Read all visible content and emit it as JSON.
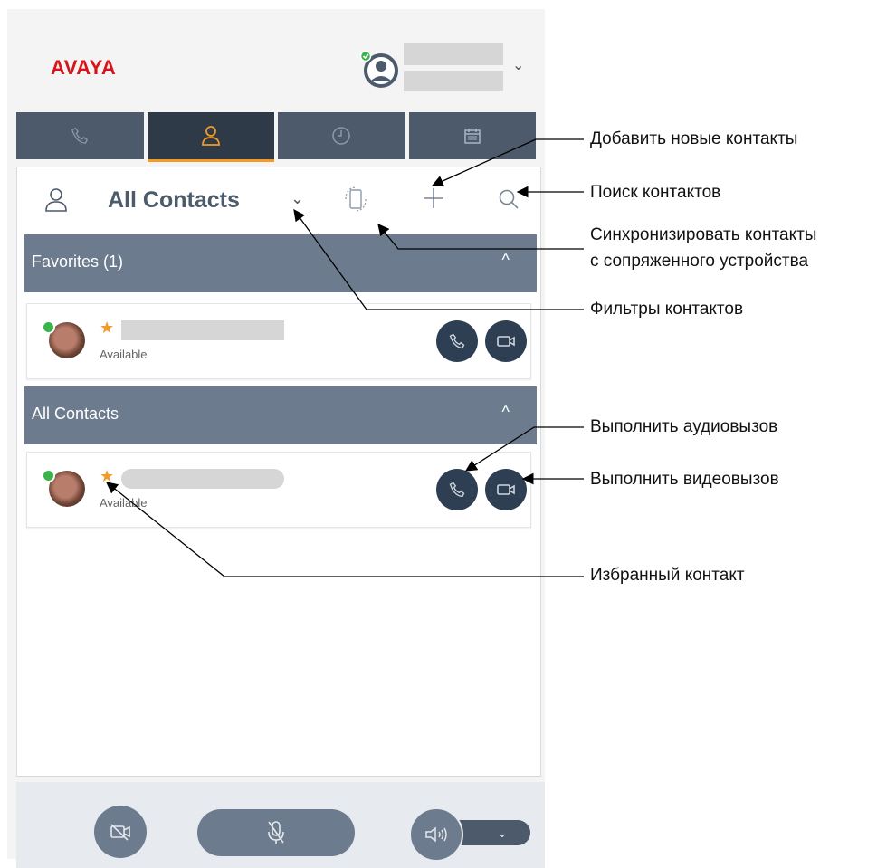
{
  "header": {
    "logo": "AVAYA",
    "account_chevron": "⌄"
  },
  "tabs": [
    {
      "icon": "phone-icon"
    },
    {
      "icon": "contacts-icon",
      "active": true
    },
    {
      "icon": "history-icon"
    },
    {
      "icon": "calendar-icon"
    }
  ],
  "contacts_header": {
    "title": "All Contacts",
    "filter_chevron": "⌄"
  },
  "groups": {
    "favorites": {
      "label": "Favorites (1)",
      "chevron": "^"
    },
    "all": {
      "label": "All Contacts",
      "chevron": "^"
    }
  },
  "contacts": [
    {
      "status": "Available",
      "favorite": true
    },
    {
      "status": "Available",
      "favorite": true
    }
  ],
  "annotations": {
    "add_contacts": "Добавить новые контакты",
    "search_contacts": "Поиск контактов",
    "sync_contacts_line1": "Синхронизировать контакты",
    "sync_contacts_line2": "с сопряженного устройства",
    "filters": "Фильтры контактов",
    "audio_call": "Выполнить аудиовызов",
    "video_call": "Выполнить видеовызов",
    "favorite_contact": "Избранный контакт"
  },
  "colors": {
    "brand_red": "#d7141a",
    "tab_bg": "#4c5a6b",
    "tab_active": "#2e3a48",
    "accent_orange": "#f39b26",
    "group_bg": "#6c7b8e",
    "button_dark": "#2f3f53",
    "presence_green": "#38b44a"
  }
}
